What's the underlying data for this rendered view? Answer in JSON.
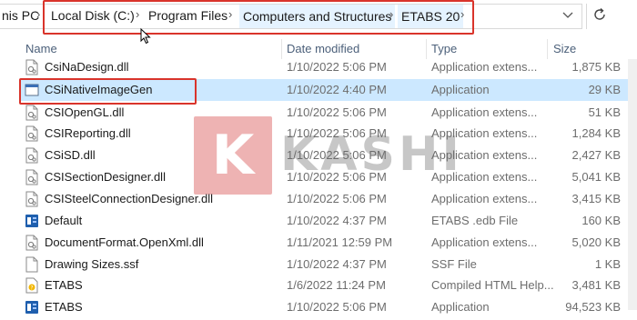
{
  "address": {
    "crumbs": [
      "nis PC",
      "Local Disk (C:)",
      "Program Files",
      "Computers and Structures",
      "ETABS 20"
    ],
    "separator": "›"
  },
  "columns": {
    "name": "Name",
    "date": "Date modified",
    "type": "Type",
    "size": "Size"
  },
  "files": [
    {
      "name": "CsiNaDesign.dll",
      "date": "1/10/2022 5:06 PM",
      "type": "Application extens...",
      "size": "1,875 KB",
      "icon": "dll-icon"
    },
    {
      "name": "CSiNativeImageGen",
      "date": "1/10/2022 4:40 PM",
      "type": "Application",
      "size": "29 KB",
      "icon": "exe-icon"
    },
    {
      "name": "CSIOpenGL.dll",
      "date": "1/10/2022 5:06 PM",
      "type": "Application extens...",
      "size": "51 KB",
      "icon": "dll-icon"
    },
    {
      "name": "CSIReporting.dll",
      "date": "1/10/2022 5:06 PM",
      "type": "Application extens...",
      "size": "1,284 KB",
      "icon": "dll-icon"
    },
    {
      "name": "CSiSD.dll",
      "date": "1/10/2022 5:06 PM",
      "type": "Application extens...",
      "size": "2,427 KB",
      "icon": "dll-icon"
    },
    {
      "name": "CSISectionDesigner.dll",
      "date": "1/10/2022 5:06 PM",
      "type": "Application extens...",
      "size": "5,041 KB",
      "icon": "dll-icon"
    },
    {
      "name": "CSISteelConnectionDesigner.dll",
      "date": "1/10/2022 5:06 PM",
      "type": "Application extens...",
      "size": "3,415 KB",
      "icon": "dll-icon"
    },
    {
      "name": "Default",
      "date": "1/10/2022 4:37 PM",
      "type": "ETABS .edb File",
      "size": "160 KB",
      "icon": "etabs-file-icon"
    },
    {
      "name": "DocumentFormat.OpenXml.dll",
      "date": "1/11/2021 12:59 PM",
      "type": "Application extens...",
      "size": "5,020 KB",
      "icon": "dll-icon"
    },
    {
      "name": "Drawing Sizes.ssf",
      "date": "1/10/2022 4:37 PM",
      "type": "SSF File",
      "size": "1 KB",
      "icon": "blank-file-icon"
    },
    {
      "name": "ETABS",
      "date": "1/6/2022 11:24 PM",
      "type": "Compiled HTML Help...",
      "size": "3,481 KB",
      "icon": "help-file-icon"
    },
    {
      "name": "ETABS",
      "date": "1/10/2022 5:06 PM",
      "type": "Application",
      "size": "94,523 KB",
      "icon": "etabs-file-icon"
    }
  ],
  "watermark": {
    "letter": "K",
    "text": "KASHI"
  }
}
